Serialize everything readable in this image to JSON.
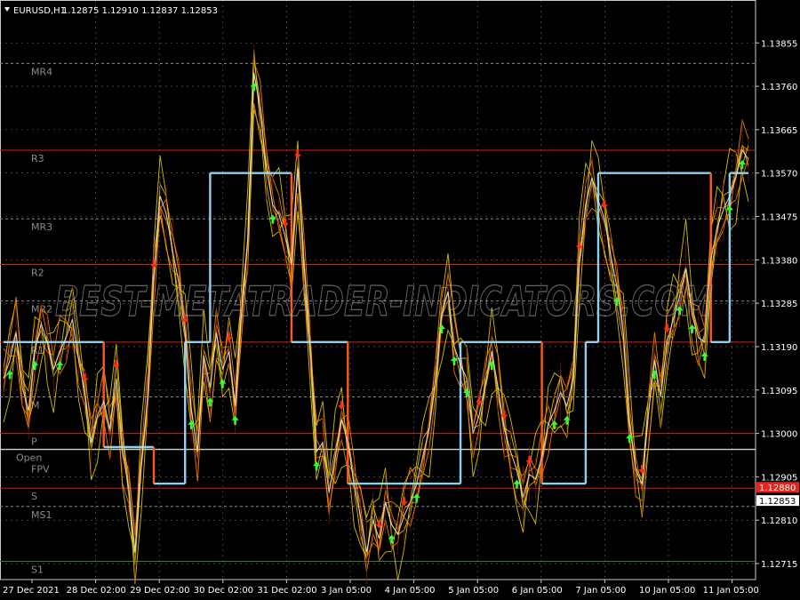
{
  "header": {
    "symbol": "EURUSD,H1",
    "ohlc": "1.12875 1.12910 1.12837 1.12853"
  },
  "watermark": "BEST-METATRADER-INDICATORS.COM",
  "colors": {
    "background": "#000000",
    "grid": "#c0c0c0",
    "red_level": "#d81b1b",
    "gray_level": "#8c8c8c",
    "green_level": "#2e7d32",
    "pivot_line": "#8ed0f0",
    "pivot_line_alt": "#ff5a1a",
    "band_yellow": "#e5d400",
    "band_orange": "#ff8c00",
    "price_white": "#e8e8e8",
    "arrow_up": "#2cff3c",
    "arrow_down": "#ff2a1a",
    "price_label_bg": "#e8231b"
  },
  "chart_data": {
    "type": "line",
    "title": "EURUSD,H1",
    "y_ticks": [
      1.13855,
      1.1376,
      1.13665,
      1.1357,
      1.13475,
      1.1338,
      1.13285,
      1.1319,
      1.13095,
      1.13,
      1.12905,
      1.1281,
      1.12715
    ],
    "y_tick_labels": [
      "1.13855",
      "1.13760",
      "1.13665",
      "1.13570",
      "1.13475",
      "1.13380",
      "1.13285",
      "1.13190",
      "1.13095",
      "1.13000",
      "1.12905",
      "1.12810",
      "1.12715"
    ],
    "ylim": [
      1.1268,
      1.1391
    ],
    "x_tick_labels": [
      "27 Dec 2021",
      "28 Dec 02:00",
      "29 Dec 02:00",
      "30 Dec 02:00",
      "31 Dec 02:00",
      "3 Jan 05:00",
      "4 Jan 05:00",
      "5 Jan 05:00",
      "6 Jan 05:00",
      "7 Jan 05:00",
      "10 Jan 05:00",
      "11 Jan 05:00"
    ],
    "x_count": 120,
    "current_price": "1.12853",
    "current_price_marker": "1.12880",
    "levels": [
      {
        "label": "MR4",
        "value": 1.1381,
        "color": "gray"
      },
      {
        "label": "R3",
        "value": 1.1362,
        "color": "red"
      },
      {
        "label": "MR3",
        "value": 1.1347,
        "color": "gray"
      },
      {
        "label": "R2",
        "value": 1.1337,
        "color": "red"
      },
      {
        "label": "MR2",
        "value": 1.1329,
        "color": "gray"
      },
      {
        "label": "R1",
        "value": 1.132,
        "color": "red"
      },
      {
        "label": "M",
        "value": 1.1308,
        "color": "gray"
      },
      {
        "label": "P",
        "value": 1.13,
        "color": "red"
      },
      {
        "label": "Open",
        "value": 1.12965,
        "color": "white"
      },
      {
        "label": "FPV",
        "value": 1.1294,
        "color": "none"
      },
      {
        "label": "S",
        "value": 1.1288,
        "color": "red"
      },
      {
        "label": "MS1",
        "value": 1.1284,
        "color": "gray"
      },
      {
        "label": "S1",
        "value": 1.1272,
        "color": "green"
      }
    ],
    "series": [
      {
        "values": [
          1.1312,
          1.1316,
          1.1322,
          1.131,
          1.1305,
          1.1318,
          1.1324,
          1.132,
          1.1314,
          1.1318,
          1.1321,
          1.1325,
          1.1316,
          1.1309,
          1.1298,
          1.1304,
          1.1307,
          1.1301,
          1.1312,
          1.1296,
          1.1288,
          1.1274,
          1.1293,
          1.1308,
          1.1334,
          1.1352,
          1.1348,
          1.134,
          1.1333,
          1.1322,
          1.1305,
          1.1296,
          1.1317,
          1.131,
          1.1322,
          1.1314,
          1.1318,
          1.1306,
          1.1326,
          1.1342,
          1.1379,
          1.1371,
          1.1358,
          1.135,
          1.1348,
          1.1343,
          1.1337,
          1.1358,
          1.1337,
          1.1318,
          1.1296,
          1.1298,
          1.1287,
          1.1295,
          1.1303,
          1.1298,
          1.1289,
          1.1282,
          1.1274,
          1.1281,
          1.1277,
          1.1285,
          1.128,
          1.1278,
          1.1282,
          1.1285,
          1.1289,
          1.1295,
          1.1301,
          1.1312,
          1.1326,
          1.1331,
          1.1319,
          1.1315,
          1.1312,
          1.13,
          1.1304,
          1.1311,
          1.1318,
          1.131,
          1.1301,
          1.1296,
          1.1292,
          1.1286,
          1.1291,
          1.129,
          1.1295,
          1.1302,
          1.1305,
          1.1309,
          1.1306,
          1.1312,
          1.1338,
          1.135,
          1.1356,
          1.1351,
          1.1347,
          1.1339,
          1.1332,
          1.1322,
          1.1302,
          1.1292,
          1.1289,
          1.1304,
          1.1316,
          1.1308,
          1.132,
          1.1325,
          1.133,
          1.1336,
          1.1326,
          1.1321,
          1.132,
          1.1338,
          1.1345,
          1.1349,
          1.1352,
          1.1356,
          1.1362,
          1.136
        ]
      }
    ],
    "pivot_steps": [
      {
        "from": 0,
        "to": 16,
        "value": 1.132
      },
      {
        "from": 16,
        "to": 24,
        "value": 1.1297
      },
      {
        "from": 24,
        "to": 29,
        "value": 1.1289
      },
      {
        "from": 29,
        "to": 33,
        "value": 1.132
      },
      {
        "from": 33,
        "to": 46,
        "value": 1.1357
      },
      {
        "from": 46,
        "to": 55,
        "value": 1.132
      },
      {
        "from": 55,
        "to": 73,
        "value": 1.1289
      },
      {
        "from": 73,
        "to": 86,
        "value": 1.132
      },
      {
        "from": 86,
        "to": 93,
        "value": 1.1289
      },
      {
        "from": 93,
        "to": 95,
        "value": 1.132
      },
      {
        "from": 95,
        "to": 113,
        "value": 1.1357
      },
      {
        "from": 113,
        "to": 116,
        "value": 1.132
      },
      {
        "from": 116,
        "to": 120,
        "value": 1.1357
      }
    ],
    "arrows_up": [
      1,
      5,
      9,
      30,
      33,
      35,
      37,
      40,
      43,
      50,
      62,
      66,
      70,
      72,
      74,
      78,
      82,
      88,
      90,
      98,
      100,
      104,
      108,
      110,
      112,
      116,
      118
    ],
    "arrows_down": [
      13,
      18,
      24,
      29,
      36,
      45,
      47,
      54,
      60,
      64,
      76,
      80,
      84,
      92,
      96,
      102,
      106
    ]
  }
}
